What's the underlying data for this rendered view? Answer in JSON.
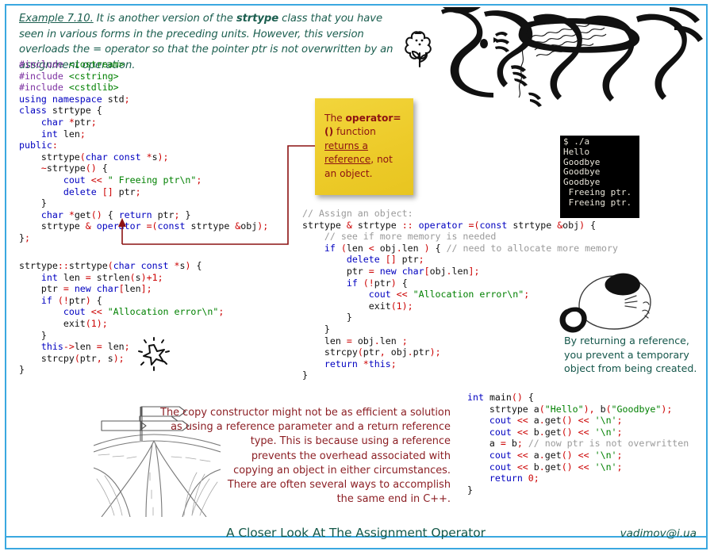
{
  "slide": {
    "border_color": "#3aa8e0",
    "background": "#ffffff"
  },
  "intro": {
    "example_label": "Example 7.10.",
    "text": " It is another version of the ",
    "bold_term": "strtype",
    "text2": " class that you have seen in various forms in the preceding units. However, this version overloads the = operator so that the pointer ptr is not overwritten by an assignment operation."
  },
  "code_blocks": {
    "class_definition": {
      "name": "strtype class declaration",
      "lines": [
        "#include <iostream>",
        "#include <cstring>",
        "#include <cstdlib>",
        "using namespace std;",
        "class strtype {",
        "    char *ptr;",
        "    int len;",
        "public:",
        "    strtype(char const *s);",
        "    ~strtype() {",
        "        cout << \" Freeing ptr\\n\";",
        "        delete [] ptr;",
        "    }",
        "    char *get() { return ptr; }",
        "    strtype & operator =(const strtype &obj);",
        "};"
      ]
    },
    "constructor": {
      "name": "strtype constructor definition",
      "lines": [
        "strtype::strtype(char const *s) {",
        "    int len = strlen(s)+1;",
        "    ptr = new char[len];",
        "    if (!ptr) {",
        "        cout << \"Allocation error\\n\";",
        "        exit(1);",
        "    }",
        "    this->len = len;",
        "    strcpy(ptr, s);",
        "}"
      ]
    },
    "operator_overload": {
      "name": "assignment operator definition",
      "lines": [
        "// Assign an object:",
        "strtype & strtype :: operator =(const strtype &obj) {",
        "    // see if more memory is needed",
        "    if (len < obj.len ) { // need to allocate more memory",
        "        delete [] ptr;",
        "        ptr = new char[obj.len];",
        "        if (!ptr) {",
        "            cout << \"Allocation error\\n\";",
        "            exit(1);",
        "        }",
        "    }",
        "    len = obj.len ;",
        "    strcpy(ptr, obj.ptr);",
        "    return *this;",
        "}"
      ]
    },
    "main_function": {
      "name": "main function",
      "lines": [
        "int main() {",
        "    strtype a(\"Hello\"), b(\"Goodbye\");",
        "    cout << a.get() << '\\n';",
        "    cout << b.get() << '\\n';",
        "    a = b; // now ptr is not overwritten",
        "    cout << a.get() << '\\n';",
        "    cout << b.get() << '\\n';",
        "    return 0;",
        "}"
      ]
    }
  },
  "sticky_note": {
    "part1": "The ",
    "bold": "operator=()",
    "part2": " function ",
    "underlined": "returns a reference",
    "part3": ", not an object.",
    "color": "#edcb2a",
    "text_color": "#8c1212"
  },
  "terminal": {
    "lines": [
      "$ ./a",
      "Hello",
      "Goodbye",
      "Goodbye",
      "Goodbye",
      " Freeing ptr.",
      " Freeing ptr."
    ],
    "background": "#000000",
    "text_color": "#e8e4d8"
  },
  "annotations": {
    "green_note": "By returning a reference, you prevent a temporary object from being created.",
    "green_color": "#14564a",
    "maroon_note_lines": [
      "The copy constructor might not be as efficient a solution",
      "as using a reference parameter and a return reference",
      "type. This is because using a reference",
      "prevents the overhead associated with",
      "copying an object in either circumstances.",
      "There are often several ways to accomplish",
      "the same end in C++."
    ],
    "maroon_color": "#8c1f24"
  },
  "footer": {
    "title": "A Closer Look At The Assignment Operator",
    "email": "vadimov@i.ua",
    "color": "#15594a"
  },
  "icons": {
    "flower": "flower-doodle",
    "sparkle": "sparkle-doodle",
    "cat": "sleeping-cat-doodle",
    "artwork": "abstract-line-art",
    "signpost": "forked-road-signpost-sketch",
    "connector": "callout-connector-arrow"
  }
}
